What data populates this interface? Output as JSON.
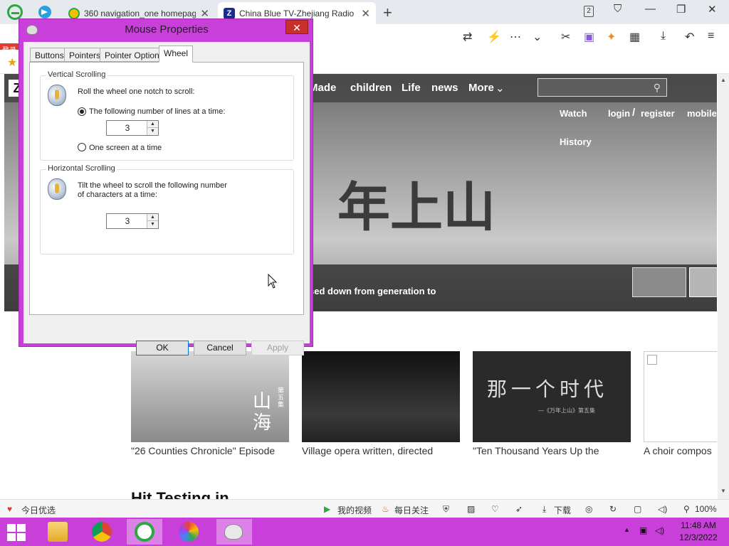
{
  "browser": {
    "tabs": [
      {
        "title": "360 navigation_one homepage",
        "close": "✕"
      },
      {
        "title": "China Blue TV-Zhejiang Radio",
        "close": "✕"
      }
    ],
    "new_tab": "+",
    "window_count": "2",
    "login_badge": "登录",
    "window_controls": {
      "minimize": "—",
      "restore": "❐",
      "close": "✕"
    }
  },
  "site": {
    "nav": [
      "Made",
      "children",
      "Life",
      "news",
      "More"
    ],
    "top_links": {
      "watch": "Watch",
      "login": "login",
      "separator": "/",
      "register": "register",
      "mobile": "mobile",
      "history": "History"
    },
    "hero_caption": "sed down from generation to",
    "cards": [
      {
        "title": "\"26 Counties Chronicle\" Episode",
        "overlay": "山海",
        "tag": "第五集"
      },
      {
        "title": "Village opera written, directed"
      },
      {
        "title": "\"Ten Thousand Years Up the",
        "overlay": "那一个时代",
        "sub": "—《万年上山》第五集"
      },
      {
        "title": "A choir compos"
      }
    ],
    "section_heading": "Hit Testing in"
  },
  "dialog": {
    "title": "Mouse Properties",
    "close": "✕",
    "tabs": [
      "Buttons",
      "Pointers",
      "Pointer Options",
      "Wheel"
    ],
    "active_tab": "Wheel",
    "vertical": {
      "label": "Vertical Scrolling",
      "instruction": "Roll the wheel one notch to scroll:",
      "option_lines": "The following number of lines at a time:",
      "lines_value": "3",
      "option_screen": "One screen at a time"
    },
    "horizontal": {
      "label": "Horizontal Scrolling",
      "instruction_1": "Tilt the wheel to scroll the following number",
      "instruction_2": "of characters at a time:",
      "chars_value": "3"
    },
    "buttons": {
      "ok": "OK",
      "cancel": "Cancel",
      "apply": "Apply"
    }
  },
  "statusbar": {
    "left": "今日优选",
    "my_video": "我的视频",
    "daily_focus": "每日关注",
    "download": "下载",
    "zoom": "100%"
  },
  "taskbar": {
    "time": "11:48 AM",
    "date": "12/3/2022"
  },
  "colors": {
    "accent": "#c93fd9",
    "close_red": "#c9302c",
    "browser_bar": "#e6e9ee"
  }
}
